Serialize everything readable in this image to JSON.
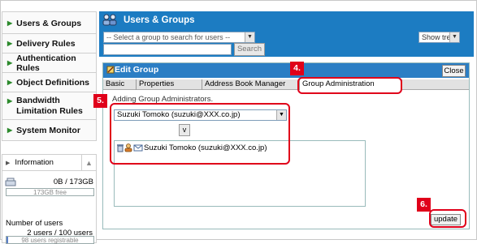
{
  "sidebar": {
    "items": [
      {
        "label": "Users & Groups"
      },
      {
        "label": "Delivery Rules"
      },
      {
        "label": "Authentication Rules"
      },
      {
        "label": "Object Definitions"
      },
      {
        "label": "Bandwidth Limitation Rules"
      },
      {
        "label": "System Monitor"
      }
    ],
    "info": {
      "title": "Information",
      "disk_usage": "0B / 173GB",
      "disk_free": "173GB free",
      "disk_fraction": 0.0,
      "users_label": "Number of users",
      "users_value": "2 users / 100 users",
      "users_registrable": "98 users registrable",
      "users_fraction": 0.02
    }
  },
  "header": {
    "title": "Users & Groups",
    "group_select_placeholder": "-- Select a group to search for users --",
    "show_tree": "Show tree",
    "search_button": "Search"
  },
  "edit_group": {
    "title": "Edit Group",
    "close_button": "Close",
    "tabs": [
      "Basic",
      "Properties",
      "Address Book Manager",
      "Group Administration"
    ],
    "section_label": "Adding Group Administrators.",
    "member_select_value": "Suzuki Tomoko (suzuki@XXX.co.jp)",
    "move_button": "v",
    "admins": [
      "Suzuki Tomoko (suzuki@XXX.co.jp)"
    ],
    "update_button": "update"
  },
  "callouts": [
    "4.",
    "5.",
    "6."
  ],
  "colors": {
    "header_blue": "#1c7cc2",
    "panel_header_blue": "#2b7ec4",
    "highlight_red": "#e0001a",
    "nav_arrow_green": "#2c8a2c"
  }
}
